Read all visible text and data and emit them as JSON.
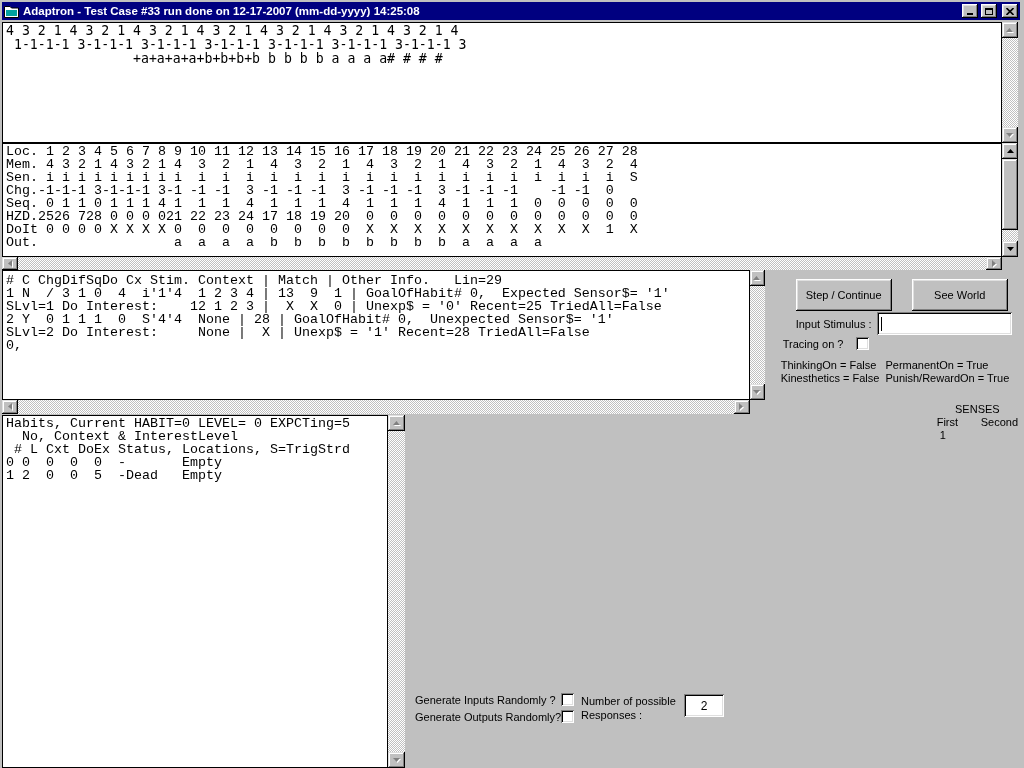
{
  "window": {
    "title": "Adaptron - Test Case #33 run done on 12-17-2007 (mm-dd-yyyy) 14:25:08"
  },
  "sequence_trace": {
    "lines": [
      "4 3 2 1 4 3 2 1 4 3 2 1 4 3 2 1 4 3 2 1 4 3 2 1 4 3 2 1 4",
      " 1-1-1-1 3-1-1-1 3-1-1-1 3-1-1-1 3-1-1-1 3-1-1-1 3-1-1-1 3",
      "                +a+a+a+a+b+b+b+b b b b b a a a a# # # #"
    ],
    "scroll_enabled": false
  },
  "memory_table": {
    "lines": [
      "Loc. 1 2 3 4 5 6 7 8 9 10 11 12 13 14 15 16 17 18 19 20 21 22 23 24 25 26 27 28",
      "Mem. 4 3 2 1 4 3 2 1 4  3  2  1  4  3  2  1  4  3  2  1  4  3  2  1  4  3  2  4",
      "Sen. i i i i i i i i i  i  i  i  i  i  i  i  i  i  i  i  i  i  i  i  i  i  i  S",
      "Chg.-1-1-1 3-1-1-1 3-1 -1 -1  3 -1 -1 -1  3 -1 -1 -1  3 -1 -1 -1    -1 -1  0",
      "Seq. 0 1 1 0 1 1 1 4 1  1  1  4  1  1  1  4  1  1  1  4  1  1  1  0  0  0  0  0",
      "HZD.2526 728 0 0 0 021 22 23 24 17 18 19 20  0  0  0  0  0  0  0  0  0  0  0  0",
      "DoIt 0 0 0 0 X X X X 0  0  0  0  0  0  0  0  X  X  X  X  X  X  X  X  X  X  1  X",
      "Out.                 a  a  a  a  b  b  b  b  b  b  b  b  a  a  a  a"
    ],
    "vertical_scroll_enabled": true,
    "horizontal_scroll_enabled": false
  },
  "habit_detail": {
    "lines": [
      "# C ChgDifSqDo Cx Stim. Context | Match | Other Info.   Lin=29",
      "1 N  / 3 1 0  4  i'1'4  1 2 3 4 | 13  9  1 | GoalOfHabit# 0,  Expected Sensor$= '1'",
      "SLvl=1 Do Interest:    12 1 2 3 |  X  X  0 | Unexp$ = '0' Recent=25 TriedAll=False",
      "2 Y  0 1 1 1  0  S'4'4  None | 28 | GoalOfHabit# 0,  Unexpected Sensor$= '1'",
      "SLvl=2 Do Interest:     None |  X | Unexp$ = '1' Recent=28 TriedAll=False",
      "0,"
    ],
    "scroll_enabled": false
  },
  "controls": {
    "buttons": [
      "Step / Continue",
      "See World"
    ],
    "input_stimulus": {
      "label": "Input Stimulus :",
      "focused": true
    },
    "tracing": {
      "label": "Tracing on ?",
      "checked": false
    },
    "flags": [
      "ThinkingOn = False",
      "PermanentOn = True",
      "Kinesthetics = False",
      "Punish/RewardOn = True"
    ]
  },
  "senses": {
    "title": "SENSES",
    "columns": [
      "First",
      "Second"
    ],
    "values": [
      "1"
    ]
  },
  "habits": {
    "lines": [
      "Habits, Current HABIT=0 LEVEL= 0 EXPCTing=5",
      "  No, Context & InterestLevel",
      " # L Cxt DoEx Status, Locations, S=TrigStrd",
      "0 0  0  0  0  -       Empty",
      "1 2  0  0  5  -Dead   Empty"
    ],
    "scroll_enabled": false
  },
  "random_options": [
    {
      "label": "Generate Inputs Randomly ?",
      "checked": false
    },
    {
      "label": "Generate Outputs Randomly?",
      "checked": false
    }
  ],
  "responses": {
    "label": "Number of possible Responses :",
    "value": "2"
  }
}
